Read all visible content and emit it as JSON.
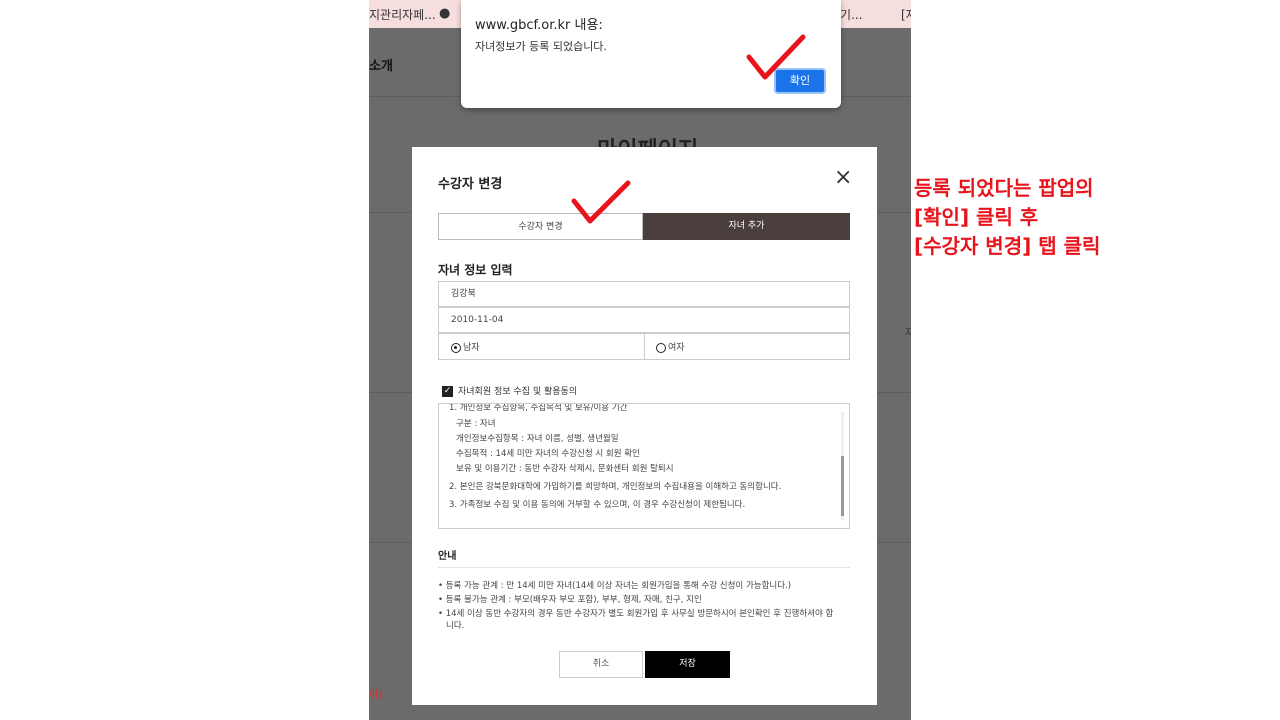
{
  "browser_tabs": {
    "tab1": "지관리자페...",
    "tab2": "산기...",
    "tab3": "[자"
  },
  "background": {
    "nav_label": "소개",
    "page_title": "마이페이지",
    "side_text": "자",
    "red_text": "이)"
  },
  "alert": {
    "origin": "www.gbcf.or.kr 내용:",
    "message": "자녀정보가 등록 되었습니다.",
    "ok_label": "확인"
  },
  "modal": {
    "title": "수강자 변경",
    "close": "×",
    "tabs": [
      "수강자 변경",
      "자녀 추가"
    ],
    "section_title": "자녀 정보 입력",
    "name_value": "김강북",
    "birth_value": "2010-11-04",
    "gender_options": [
      "남자",
      "여자"
    ],
    "gender_selected": "남자",
    "agree_label": "자녀회원 정보 수집 및 활용동의",
    "terms": [
      "1. 개인정보 수집항목, 수집목적 및 보유/이용 기간",
      "구분 : 자녀",
      "개인정보수집항목 : 자녀 이름, 성별, 생년월일",
      "수집목적 : 14세 미만 자녀의 수강신청 시 회원 확인",
      "보유 및 이용기간 : 동반 수강자 삭제시, 문화센터 회원 탈퇴시",
      "2. 본인은 강북문화대학에 가입하기를 희망하며, 개인정보의 수집내용을 이해하고 동의합니다.",
      "3. 가족정보 수집 및 이용 동의에 거부할 수 있으며, 이 경우 수강신청이 제한됩니다."
    ],
    "guide_title": "안내",
    "guide_items": [
      "• 등록 가능 관계 : 만 14세 미만 자녀(14세 이상 자녀는 회원가입을 통해 수강 신청이 가능합니다.)",
      "• 등록 불가능 관계 : 부모(배우자 부모 포함), 부부, 형제, 자매, 친구, 지인",
      "• 14세 이상 동반 수강자의 경우 동반 수강자가 별도 회원가입 후 사무실 방문하시어 본인확인 후 진행하셔야 합",
      "니다."
    ],
    "cancel_label": "취소",
    "save_label": "저장"
  },
  "annotation": {
    "lines": [
      "등록 되었다는 팝업의",
      "[확인] 클릭 후",
      "[수강자 변경] 탭 클릭"
    ],
    "color": "#e8141c"
  }
}
